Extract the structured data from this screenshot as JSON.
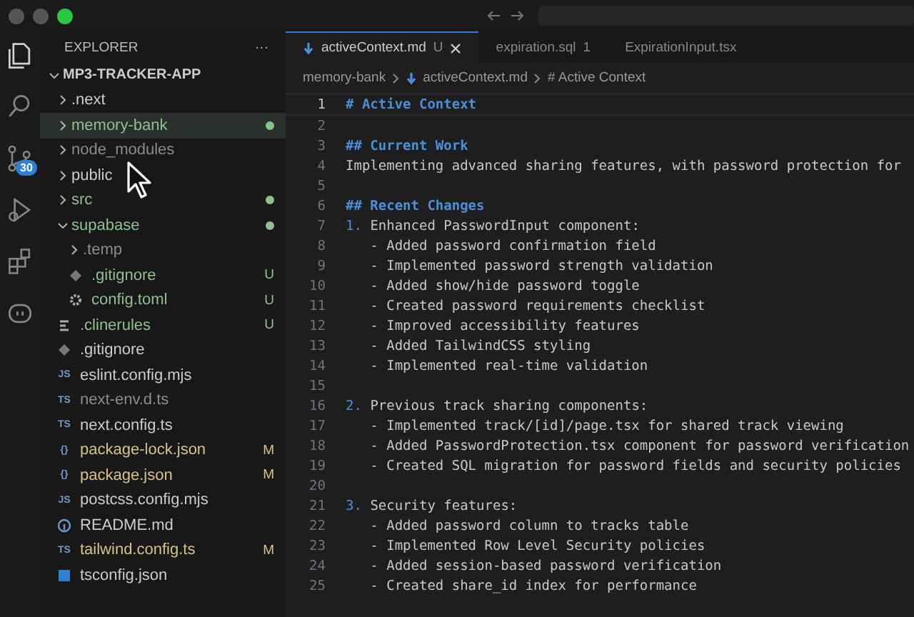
{
  "activity_bar": {
    "items": [
      {
        "kind": "files",
        "selected": true
      },
      {
        "kind": "search",
        "selected": false
      },
      {
        "kind": "source-control",
        "selected": false,
        "badge": "30"
      },
      {
        "kind": "run",
        "selected": false
      },
      {
        "kind": "extensions",
        "selected": false
      },
      {
        "kind": "bot",
        "selected": false
      }
    ]
  },
  "sidebar": {
    "title": "EXPLORER",
    "more": "···",
    "root": {
      "label": "MP3-TRACKER-APP",
      "expanded": true,
      "children": [
        {
          "kind": "folder",
          "label": ".next",
          "expanded": false,
          "selected": false
        },
        {
          "kind": "folder",
          "label": "memory-bank",
          "expanded": false,
          "selected": true,
          "color": "#8fc08f",
          "dot": true
        },
        {
          "kind": "folder",
          "label": "node_modules",
          "expanded": false,
          "selected": false,
          "color": "#8c8c8c"
        },
        {
          "kind": "folder",
          "label": "public",
          "expanded": false,
          "selected": false
        },
        {
          "kind": "folder",
          "label": "src",
          "expanded": false,
          "selected": false,
          "color": "#8fc08f",
          "dot": true
        },
        {
          "kind": "folder",
          "label": "supabase",
          "expanded": true,
          "selected": false,
          "color": "#8fc08f",
          "dot": true,
          "children": [
            {
              "kind": "folder",
              "label": ".temp",
              "expanded": false,
              "selected": false,
              "color": "#8c8c8c"
            },
            {
              "kind": "ignore-file",
              "label": ".gitignore",
              "selected": false,
              "color": "#8fc08f",
              "badge": "U"
            },
            {
              "kind": "config-file",
              "label": "config.toml",
              "selected": false,
              "color": "#8fc08f",
              "badge": "U"
            }
          ]
        },
        {
          "kind": "rules-file",
          "label": ".clinerules",
          "selected": false,
          "color": "#8fc08f",
          "badge": "U"
        },
        {
          "kind": "ignore-file",
          "label": ".gitignore",
          "selected": false
        },
        {
          "kind": "code-file",
          "icon_text": "JS",
          "label": "eslint.config.mjs",
          "selected": false
        },
        {
          "kind": "code-file",
          "icon_text": "TS",
          "label": "next-env.d.ts",
          "selected": false,
          "color": "#8c8c8c"
        },
        {
          "kind": "code-file",
          "icon_text": "TS",
          "label": "next.config.ts",
          "selected": false
        },
        {
          "kind": "code-file",
          "icon_text": "{}",
          "label": "package-lock.json",
          "selected": false,
          "color": "#d7c38a",
          "badge": "M"
        },
        {
          "kind": "code-file",
          "icon_text": "{}",
          "label": "package.json",
          "selected": false,
          "color": "#d7c38a",
          "badge": "M"
        },
        {
          "kind": "code-file",
          "icon_text": "JS",
          "label": "postcss.config.mjs",
          "selected": false
        },
        {
          "kind": "readme-file",
          "label": "README.md",
          "selected": false
        },
        {
          "kind": "code-file",
          "icon_text": "TS",
          "label": "tailwind.config.ts",
          "selected": false,
          "color": "#d7c38a",
          "badge": "M"
        },
        {
          "kind": "tsconfig-file",
          "label": "tsconfig.json",
          "selected": false
        }
      ]
    }
  },
  "tabs": [
    {
      "label": "activeContext.md",
      "selected": true,
      "badge": "U",
      "closable": true
    },
    {
      "label": "expiration.sql",
      "selected": false,
      "badge": "1"
    },
    {
      "label": "ExpirationInput.tsx",
      "selected": false
    }
  ],
  "breadcrumb": [
    "memory-bank",
    "activeContext.md",
    "# Active Context"
  ],
  "editor": {
    "lines": [
      {
        "number": "1",
        "kind": "heading",
        "text": "# Active Context",
        "current": true
      },
      {
        "number": "2",
        "kind": "blank"
      },
      {
        "number": "3",
        "kind": "heading",
        "text": "## Current Work"
      },
      {
        "number": "4",
        "kind": "text",
        "text": "Implementing advanced sharing features, with password protection for"
      },
      {
        "number": "5",
        "kind": "blank"
      },
      {
        "number": "6",
        "kind": "heading",
        "text": "## Recent Changes"
      },
      {
        "number": "7",
        "kind": "numbered",
        "marker": "1.",
        "text": "Enhanced PasswordInput component:"
      },
      {
        "number": "8",
        "kind": "text",
        "text": "   - Added password confirmation field"
      },
      {
        "number": "9",
        "kind": "text",
        "text": "   - Implemented password strength validation"
      },
      {
        "number": "10",
        "kind": "text",
        "text": "   - Added show/hide password toggle"
      },
      {
        "number": "11",
        "kind": "text",
        "text": "   - Created password requirements checklist"
      },
      {
        "number": "12",
        "kind": "text",
        "text": "   - Improved accessibility features"
      },
      {
        "number": "13",
        "kind": "text",
        "text": "   - Added TailwindCSS styling"
      },
      {
        "number": "14",
        "kind": "text",
        "text": "   - Implemented real-time validation"
      },
      {
        "number": "15",
        "kind": "blank"
      },
      {
        "number": "16",
        "kind": "numbered",
        "marker": "2.",
        "text": "Previous track sharing components:"
      },
      {
        "number": "17",
        "kind": "text",
        "text": "   - Implemented track/[id]/page.tsx for shared track viewing"
      },
      {
        "number": "18",
        "kind": "text",
        "text": "   - Added PasswordProtection.tsx component for password verification"
      },
      {
        "number": "19",
        "kind": "text",
        "text": "   - Created SQL migration for password fields and security policies"
      },
      {
        "number": "20",
        "kind": "blank"
      },
      {
        "number": "21",
        "kind": "numbered",
        "marker": "3.",
        "text": "Security features:"
      },
      {
        "number": "22",
        "kind": "text",
        "text": "   - Added password column to tracks table"
      },
      {
        "number": "23",
        "kind": "text",
        "text": "   - Implemented Row Level Security policies"
      },
      {
        "number": "24",
        "kind": "text",
        "text": "   - Added session-based password verification"
      },
      {
        "number": "25",
        "kind": "text",
        "text": "   - Created share_id index for performance"
      }
    ]
  }
}
